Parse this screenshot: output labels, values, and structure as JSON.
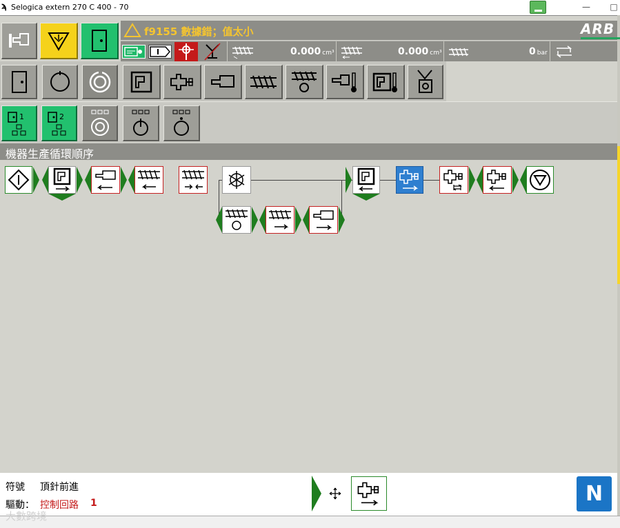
{
  "window": {
    "title": "Selogica extern  270 C  400 -  70",
    "minimize": "—",
    "maximize": "□"
  },
  "status": {
    "warning_text": "f9155 數據錯；值太小",
    "logo_text": "ARB",
    "accent_colors": {
      "green": "#22c06e",
      "yellow": "#f5d21b",
      "blue": "#2e7fd0",
      "warning": "#f4c430"
    }
  },
  "readouts": [
    {
      "value": "0.000",
      "unit": "cm³"
    },
    {
      "value": "0.000",
      "unit": "cm³"
    },
    {
      "value": "0",
      "unit": "bar"
    }
  ],
  "section": {
    "title": "機器生產循環順序"
  },
  "info": {
    "symbol_label": "符號",
    "symbol_value": "頂針前進",
    "drive_label": "驅動：",
    "drive_value": "控制回路",
    "drive_number": "1"
  },
  "n_button": "N",
  "watermark": "大數跨境",
  "icons": {
    "top_row": [
      "machine-setup-icon",
      "alarm-icon",
      "door-icon"
    ],
    "status_row": [
      "card-key-icon",
      "i-mode-icon",
      "ejector-red-icon",
      "robot-icon"
    ],
    "row2": [
      "door-icon",
      "circle-icon",
      "cycle-icon",
      "mold-icon",
      "injection-unit-icon",
      "nozzle-icon",
      "screw-icon",
      "plasticize-icon",
      "temp-icon",
      "mold-temp-icon",
      "gripper-icon"
    ],
    "row3": [
      "sequence-1-icon",
      "sequence-2-icon",
      "cycle-icon",
      "power-icon",
      "start-icon"
    ]
  }
}
